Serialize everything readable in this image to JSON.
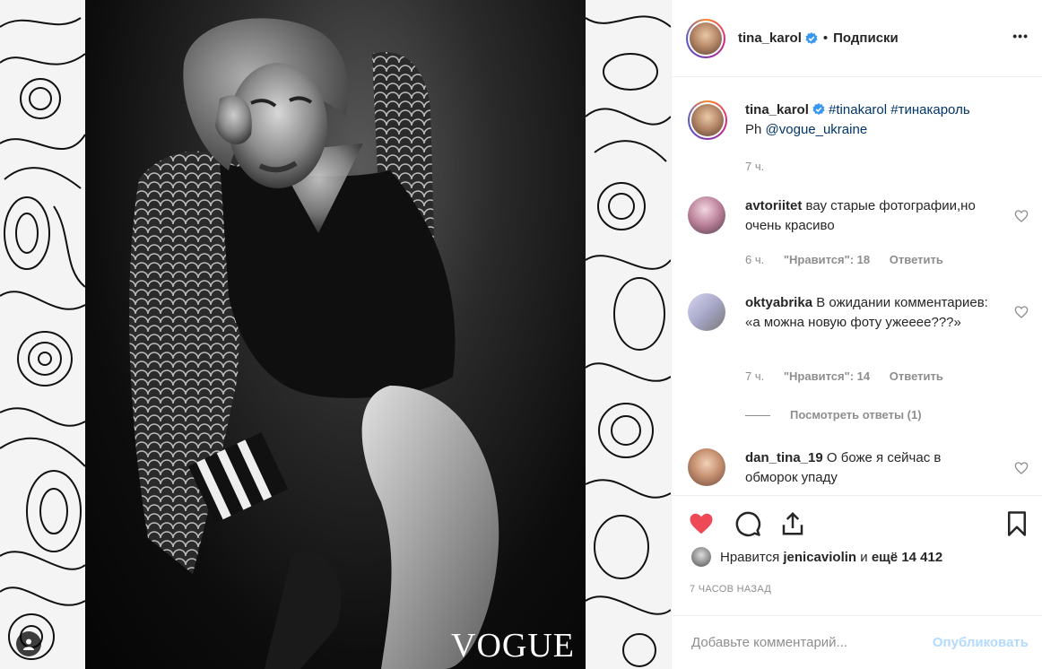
{
  "post": {
    "watermark": "VOGUE"
  },
  "header": {
    "username": "tina_karol",
    "separator": "•",
    "follow_label": "Подписки",
    "more_label": "•••"
  },
  "caption": {
    "username": "tina_karol",
    "hashtag1": "#tinakarol",
    "hashtag2": "#тинакароль",
    "text_prefix": "Ph",
    "mention": "@vogue_ukraine",
    "time": "7 ч."
  },
  "comments": [
    {
      "username": "avtoriitet",
      "text": "вау старые фотографии,но очень красиво",
      "time": "6 ч.",
      "likes": "\"Нравится\": 18",
      "reply": "Ответить"
    },
    {
      "username": "oktyabrika",
      "text": "В ожидании комментариев: «а можна новую фоту ужееее???»",
      "time": "7 ч.",
      "likes": "\"Нравится\": 14",
      "reply": "Ответить",
      "view_replies": "Посмотреть ответы (1)"
    },
    {
      "username": "dan_tina_19",
      "text": "О боже я сейчас в обморок упаду"
    }
  ],
  "likes": {
    "prefix": "Нравится",
    "user": "jenicaviolin",
    "middle": "и",
    "others": "ещё 14 412"
  },
  "timeago": "7 ЧАСОВ НАЗАД",
  "composer": {
    "placeholder": "Добавьте комментарий...",
    "publish_label": "Опубликовать"
  },
  "colors": {
    "like_red": "#ed4956",
    "link_blue": "#003569",
    "verified_blue": "#3897f0",
    "publish_disabled": "#b3dbff"
  }
}
